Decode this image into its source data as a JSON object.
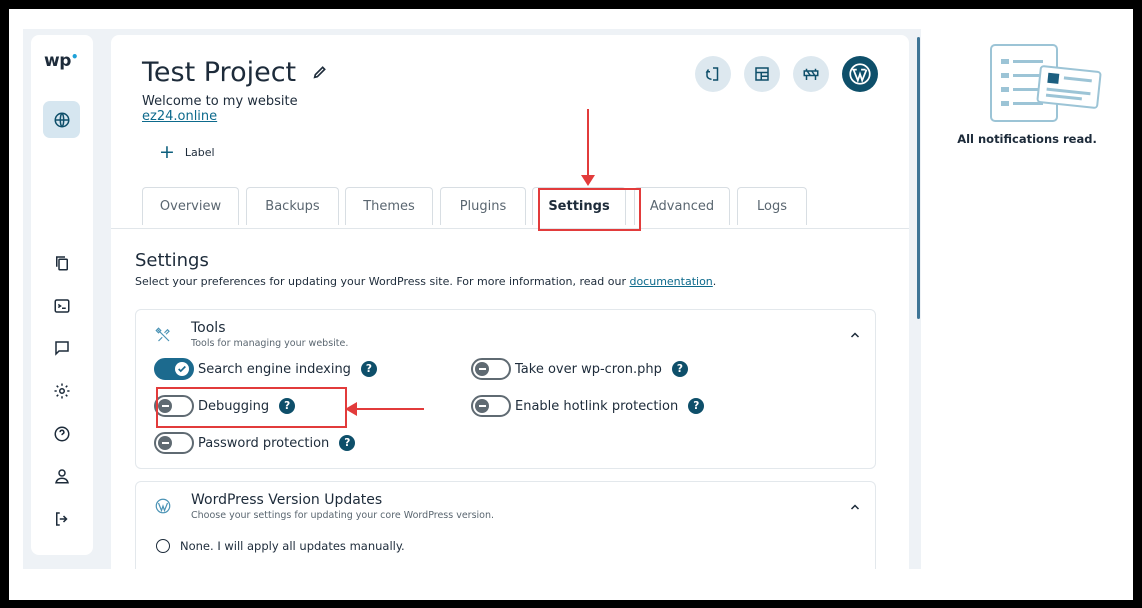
{
  "project": {
    "title": "Test Project",
    "subtitle": "Welcome to my website",
    "site_link": "ez24.online",
    "label_button": "Label"
  },
  "tabs": [
    "Overview",
    "Backups",
    "Themes",
    "Plugins",
    "Settings",
    "Advanced",
    "Logs"
  ],
  "active_tab": "Settings",
  "settings": {
    "heading": "Settings",
    "description": "Select your preferences for updating your WordPress site. For more information, read our ",
    "doc_link": "documentation",
    "desc_end": "."
  },
  "tools": {
    "title": "Tools",
    "subtitle": "Tools for managing your website.",
    "toggles": [
      {
        "label": "Search engine indexing",
        "on": true
      },
      {
        "label": "Take over wp-cron.php",
        "on": false
      },
      {
        "label": "Debugging",
        "on": false
      },
      {
        "label": "Enable hotlink protection",
        "on": false
      },
      {
        "label": "Password protection",
        "on": false
      }
    ]
  },
  "wp_updates": {
    "title": "WordPress Version Updates",
    "subtitle": "Choose your settings for updating your core WordPress version.",
    "options": [
      "None. I will apply all updates manually."
    ]
  },
  "notifications": {
    "text": "All notifications read."
  },
  "help_glyph": "?",
  "colors": {
    "accent": "#0e4f6a",
    "toggle_on": "#1c6a8e",
    "annotation_red": "#e23b3b",
    "link": "#0d6a8c"
  },
  "icons": {
    "sidebar": [
      "globe-icon",
      "copy-icon",
      "terminal-icon",
      "chat-icon",
      "gear-icon",
      "help-icon",
      "user-icon",
      "logout-icon"
    ],
    "header": [
      "php-icon",
      "layout-icon",
      "maintenance-icon",
      "wordpress-icon"
    ]
  }
}
